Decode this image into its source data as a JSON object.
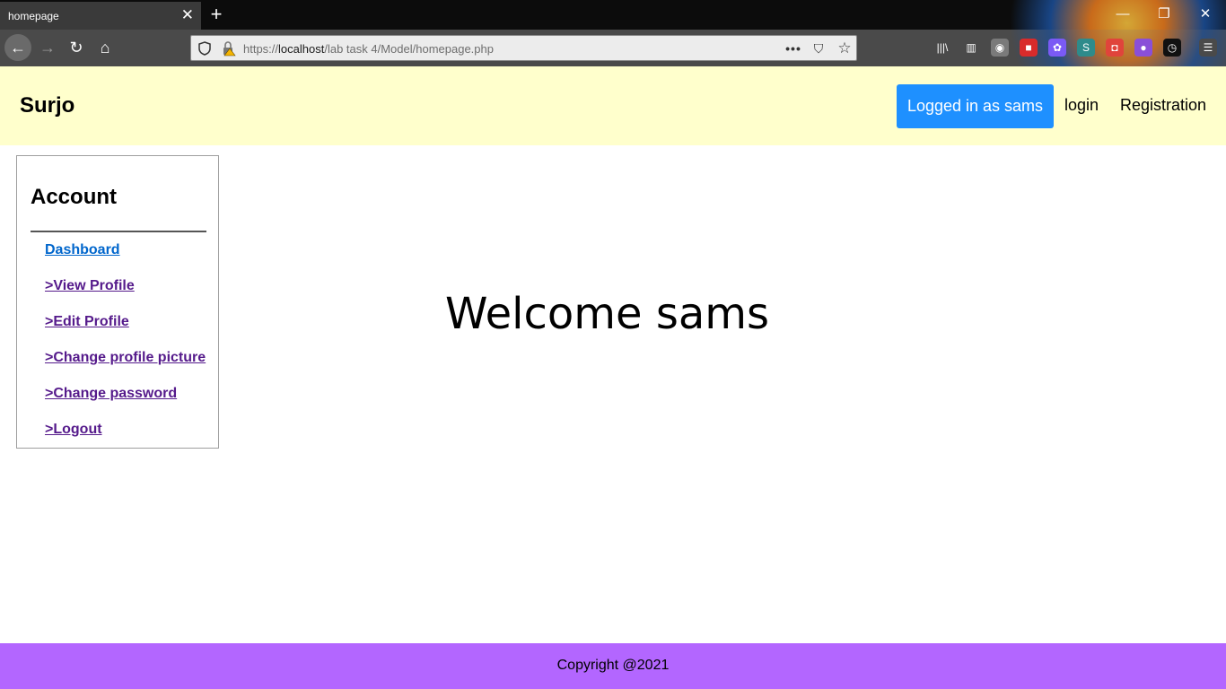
{
  "browser": {
    "tab_title": "homepage",
    "tab_close": "✕",
    "new_tab": "+",
    "window": {
      "minimize": "—",
      "maximize": "❐",
      "close": "✕"
    },
    "nav": {
      "back": "←",
      "forward": "→",
      "reload": "↻",
      "home": "⌂"
    },
    "url": {
      "scheme": "https://",
      "host": "localhost",
      "path": "/lab task 4/Model/homepage.php"
    },
    "url_actions": {
      "more": "•••",
      "pocket": "⛉",
      "star": "☆"
    },
    "toolbar_icons": [
      {
        "name": "library-icon",
        "glyph": "|||\\",
        "color": "#4a4a4a"
      },
      {
        "name": "sidebar-icon",
        "glyph": "▥",
        "color": "#4a4a4a"
      },
      {
        "name": "account-icon",
        "glyph": "◉",
        "color": "#7a7a7a"
      },
      {
        "name": "extension-red-icon",
        "glyph": "■",
        "color": "#d92b2b"
      },
      {
        "name": "extension-colorful-icon",
        "glyph": "✿",
        "color": "#7a5af5"
      },
      {
        "name": "extension-s-icon",
        "glyph": "S",
        "color": "#2e8b8b"
      },
      {
        "name": "extension-camera-icon",
        "glyph": "◘",
        "color": "#e0443b"
      },
      {
        "name": "extension-purple-icon",
        "glyph": "●",
        "color": "#8a4fd8"
      },
      {
        "name": "extension-clock-icon",
        "glyph": "◷",
        "color": "#111111"
      },
      {
        "name": "menu-icon",
        "glyph": "☰",
        "color": "#4a4a4a"
      }
    ]
  },
  "header": {
    "brand": "Surjo",
    "logged_in": "Logged in as sams",
    "login": "login",
    "registration": "Registration"
  },
  "sidebar": {
    "title": "Account",
    "links": [
      "Dashboard",
      ">View Profile",
      ">Edit Profile",
      ">Change profile picture",
      ">Change password",
      ">Logout"
    ]
  },
  "main": {
    "welcome": "Welcome sams"
  },
  "footer": {
    "copyright": "Copyright @2021"
  },
  "colors": {
    "header_bg": "#ffffcc",
    "logged_btn": "#1e90ff",
    "footer_bg": "#b366ff",
    "link_visited": "#551a8b",
    "link": "#0066cc"
  }
}
